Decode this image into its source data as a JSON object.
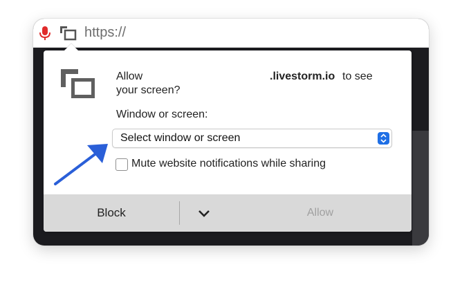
{
  "urlbar": {
    "url_text": "https://",
    "mic_icon": "microphone-icon",
    "share_icon": "screen-share-icon",
    "mic_color": "#e02b2b"
  },
  "dialog": {
    "message_prefix": "Allow",
    "domain": ".livestorm.io",
    "message_suffix": "to see",
    "message_line2": "your screen?",
    "window_label": "Window or screen:",
    "select_value": "Select window or screen",
    "checkbox_label": "Mute website notifications while sharing",
    "checkbox_checked": false,
    "block_label": "Block",
    "allow_label": "Allow",
    "allow_enabled": false,
    "accent_color": "#1f6fe5"
  },
  "annotation": {
    "arrow_color": "#2a5fd8"
  }
}
